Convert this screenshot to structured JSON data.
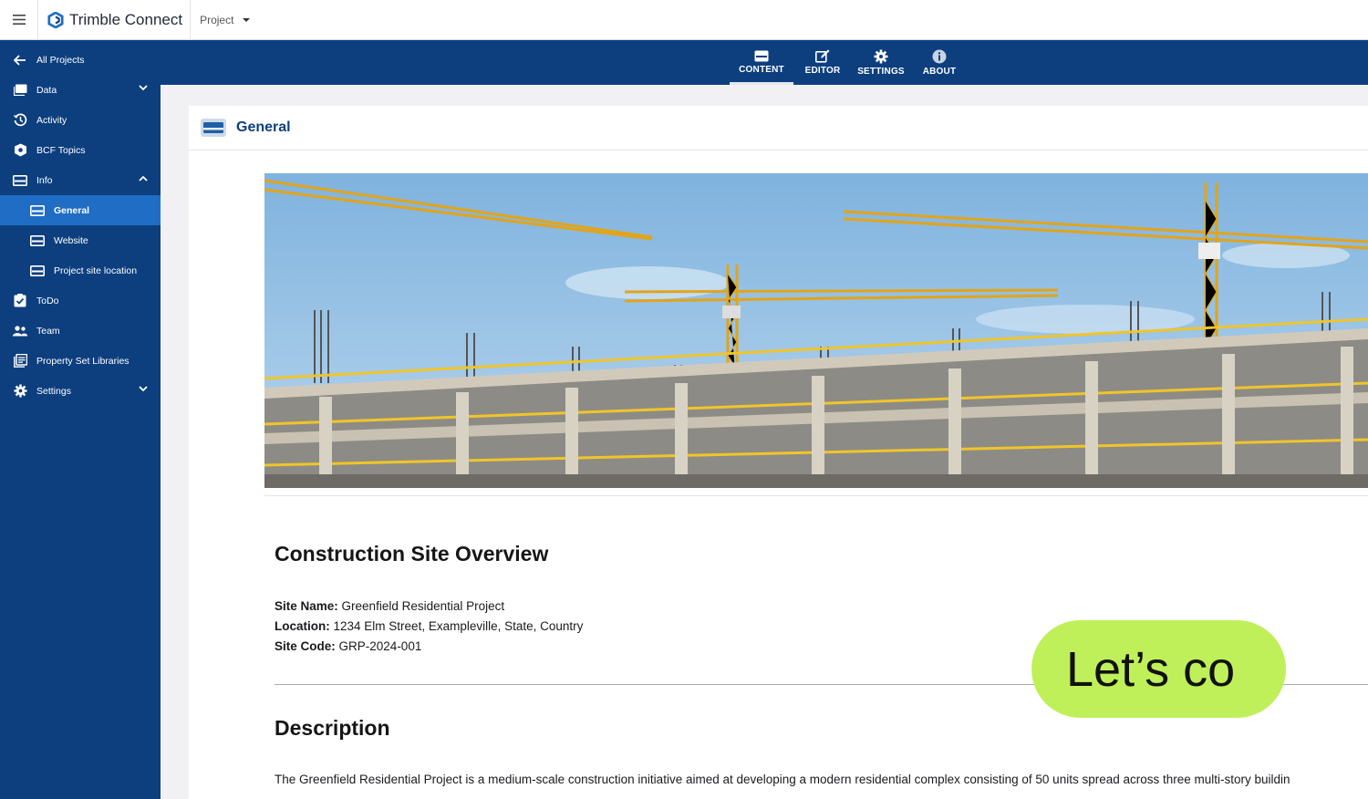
{
  "topbar": {
    "brand": "Trimble Connect",
    "project_label": "Project"
  },
  "tabs": [
    {
      "label": "CONTENT",
      "icon": "content-icon",
      "active": true
    },
    {
      "label": "EDITOR",
      "icon": "edit-icon",
      "active": false
    },
    {
      "label": "SETTINGS",
      "icon": "gear-icon",
      "active": false
    },
    {
      "label": "ABOUT",
      "icon": "info-icon",
      "active": false
    }
  ],
  "sidebar": {
    "items": [
      {
        "label": "All Projects",
        "icon": "arrow-left-icon"
      },
      {
        "label": "Data",
        "icon": "folder-icon",
        "chevron": "down"
      },
      {
        "label": "Activity",
        "icon": "history-icon"
      },
      {
        "label": "BCF Topics",
        "icon": "bcf-icon"
      },
      {
        "label": "Info",
        "icon": "info-card-icon",
        "chevron": "up"
      },
      {
        "label": "General",
        "icon": "card-icon",
        "active": true
      },
      {
        "label": "Website",
        "icon": "card-icon"
      },
      {
        "label": "Project site location",
        "icon": "card-icon"
      },
      {
        "label": "ToDo",
        "icon": "checklist-icon"
      },
      {
        "label": "Team",
        "icon": "team-icon"
      },
      {
        "label": "Property Set Libraries",
        "icon": "library-icon"
      },
      {
        "label": "Settings",
        "icon": "gear-icon",
        "chevron": "down"
      }
    ]
  },
  "page": {
    "title": "General",
    "overview_heading": "Construction Site Overview",
    "fields": [
      {
        "label": "Site Name:",
        "value": "Greenfield Residential Project"
      },
      {
        "label": "Location:",
        "value": "1234 Elm Street, Exampleville, State, Country"
      },
      {
        "label": "Site Code:",
        "value": "GRP-2024-001"
      }
    ],
    "description_heading": "Description",
    "description_text": "The Greenfield Residential Project is a medium-scale construction initiative aimed at developing a modern residential complex consisting of 50 units spread across three multi-story buildin",
    "overlay_text": "Let’s co"
  },
  "colors": {
    "brand_blue": "#0d3f7f",
    "active_blue": "#1f6dc4",
    "pill_green": "#bff05a"
  }
}
